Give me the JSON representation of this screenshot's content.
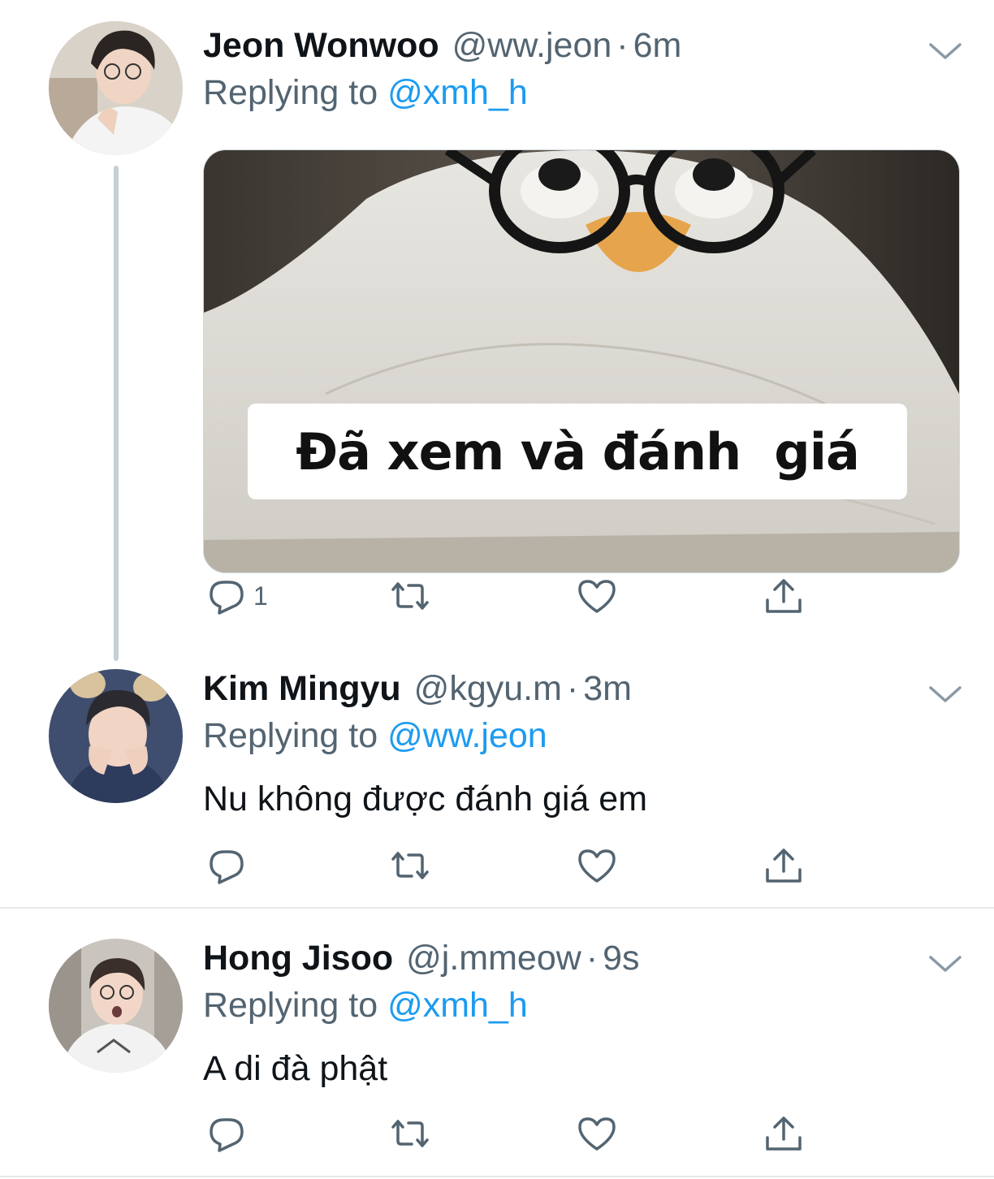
{
  "tweets": [
    {
      "name": "Jeon Wonwoo",
      "handle": "@ww.jeon",
      "separator": "·",
      "time": "6m",
      "replying_prefix": "Replying to ",
      "replying_to": "@xmh_h",
      "media_caption": "Đã xem và đánh  giá",
      "reply_count": "1",
      "icons": [
        "reply-icon",
        "retweet-icon",
        "like-icon",
        "share-icon",
        "chevron-down-icon"
      ]
    },
    {
      "name": "Kim Mingyu",
      "handle": "@kgyu.m",
      "separator": "·",
      "time": "3m",
      "replying_prefix": "Replying to ",
      "replying_to": "@ww.jeon",
      "text": "Nu không được đánh giá em",
      "reply_count": "",
      "icons": [
        "reply-icon",
        "retweet-icon",
        "like-icon",
        "share-icon",
        "chevron-down-icon"
      ]
    },
    {
      "name": "Hong Jisoo",
      "handle": "@j.mmeow",
      "separator": "·",
      "time": "9s",
      "replying_prefix": "Replying to ",
      "replying_to": "@xmh_h",
      "text": "A di đà phật",
      "reply_count": "",
      "icons": [
        "reply-icon",
        "retweet-icon",
        "like-icon",
        "share-icon",
        "chevron-down-icon"
      ]
    }
  ],
  "colors": {
    "link": "#1d9bf0",
    "secondary_text": "#536471",
    "primary_text": "#0f1419",
    "thread_line": "#c4cfd6"
  }
}
